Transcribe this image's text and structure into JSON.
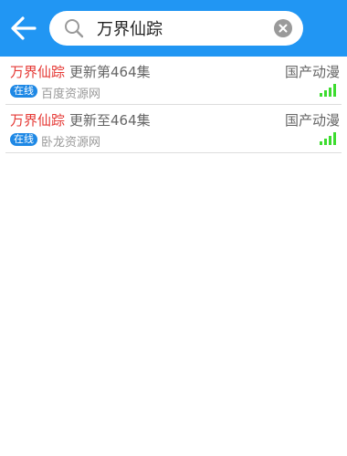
{
  "search": {
    "query": "万界仙踪"
  },
  "colors": {
    "header": "#2196f3",
    "title": "#e53935",
    "badge": "#1e88e5",
    "signal": "#3ddc2f"
  },
  "results": [
    {
      "name": "万界仙踪",
      "update": "更新第464集",
      "category": "国产动漫",
      "status": "在线",
      "source": "百度资源网",
      "icon": "signal-icon"
    },
    {
      "name": "万界仙踪",
      "update": "更新至464集",
      "category": "国产动漫",
      "status": "在线",
      "source": "卧龙资源网",
      "icon": "signal-icon"
    }
  ]
}
